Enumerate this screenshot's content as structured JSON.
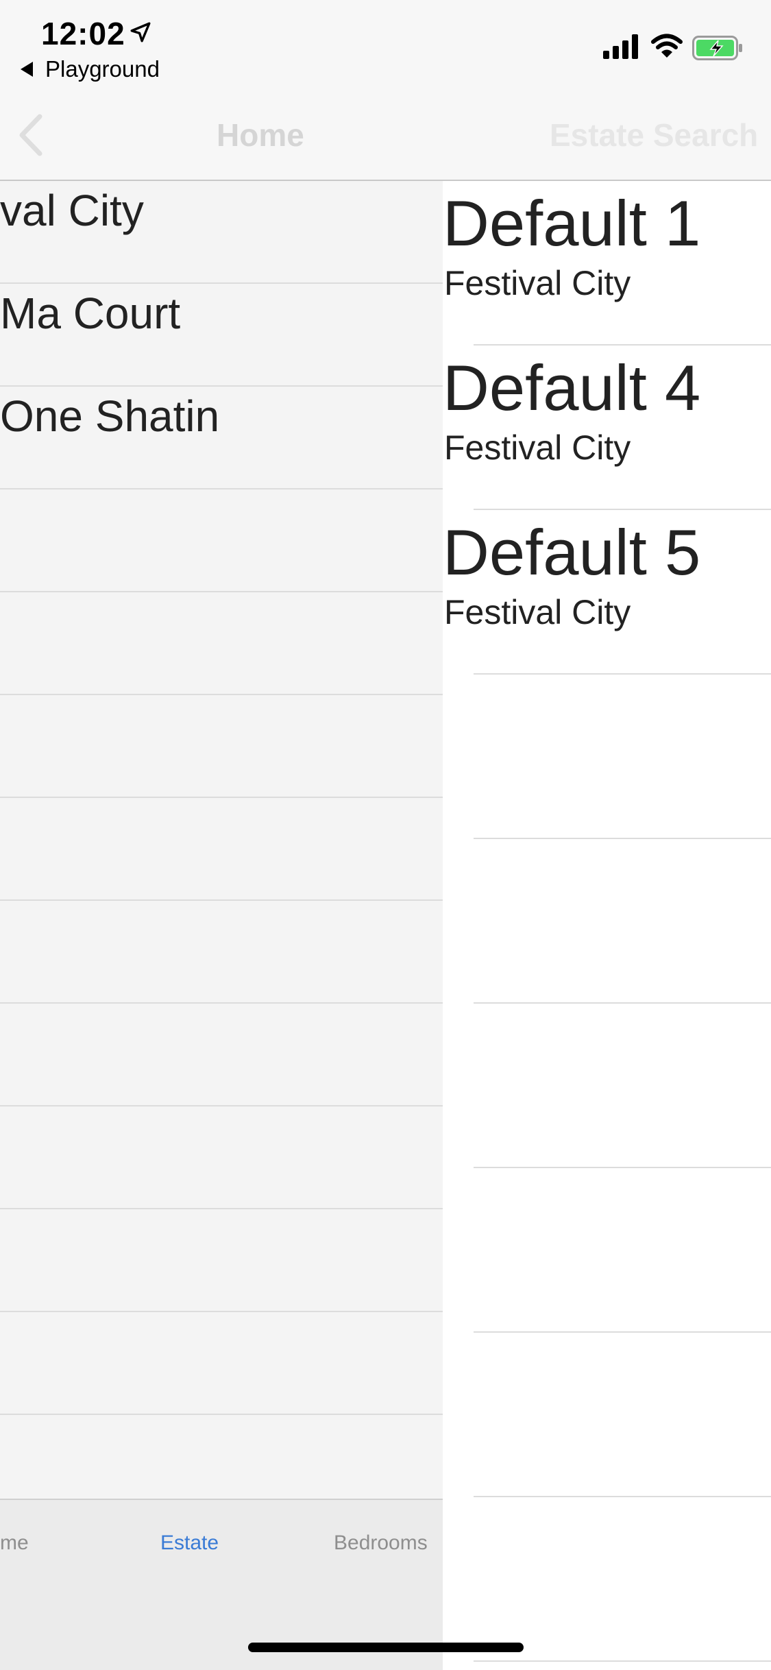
{
  "status_bar": {
    "time": "12:02",
    "back_app_label": "Playground",
    "icons": [
      "location-arrow-icon",
      "cellular-signal-icon",
      "wifi-icon",
      "battery-charging-icon"
    ],
    "battery_color": "#4cd964"
  },
  "nav_bar": {
    "title": "Home",
    "right_title": "Estate Search"
  },
  "left_list": {
    "items": [
      {
        "label": "val City"
      },
      {
        "label": "Ma Court"
      },
      {
        "label": "One Shatin"
      }
    ]
  },
  "tab_bar": {
    "tabs": [
      {
        "label": "me"
      },
      {
        "label": "Estate",
        "active": true
      },
      {
        "label": "Bedrooms"
      }
    ],
    "active_color": "#3a7bd5"
  },
  "right_list": {
    "items": [
      {
        "title": "Default 1",
        "subtitle": "Festival City"
      },
      {
        "title": "Default 4",
        "subtitle": "Festival City"
      },
      {
        "title": "Default 5",
        "subtitle": "Festival City"
      }
    ]
  }
}
